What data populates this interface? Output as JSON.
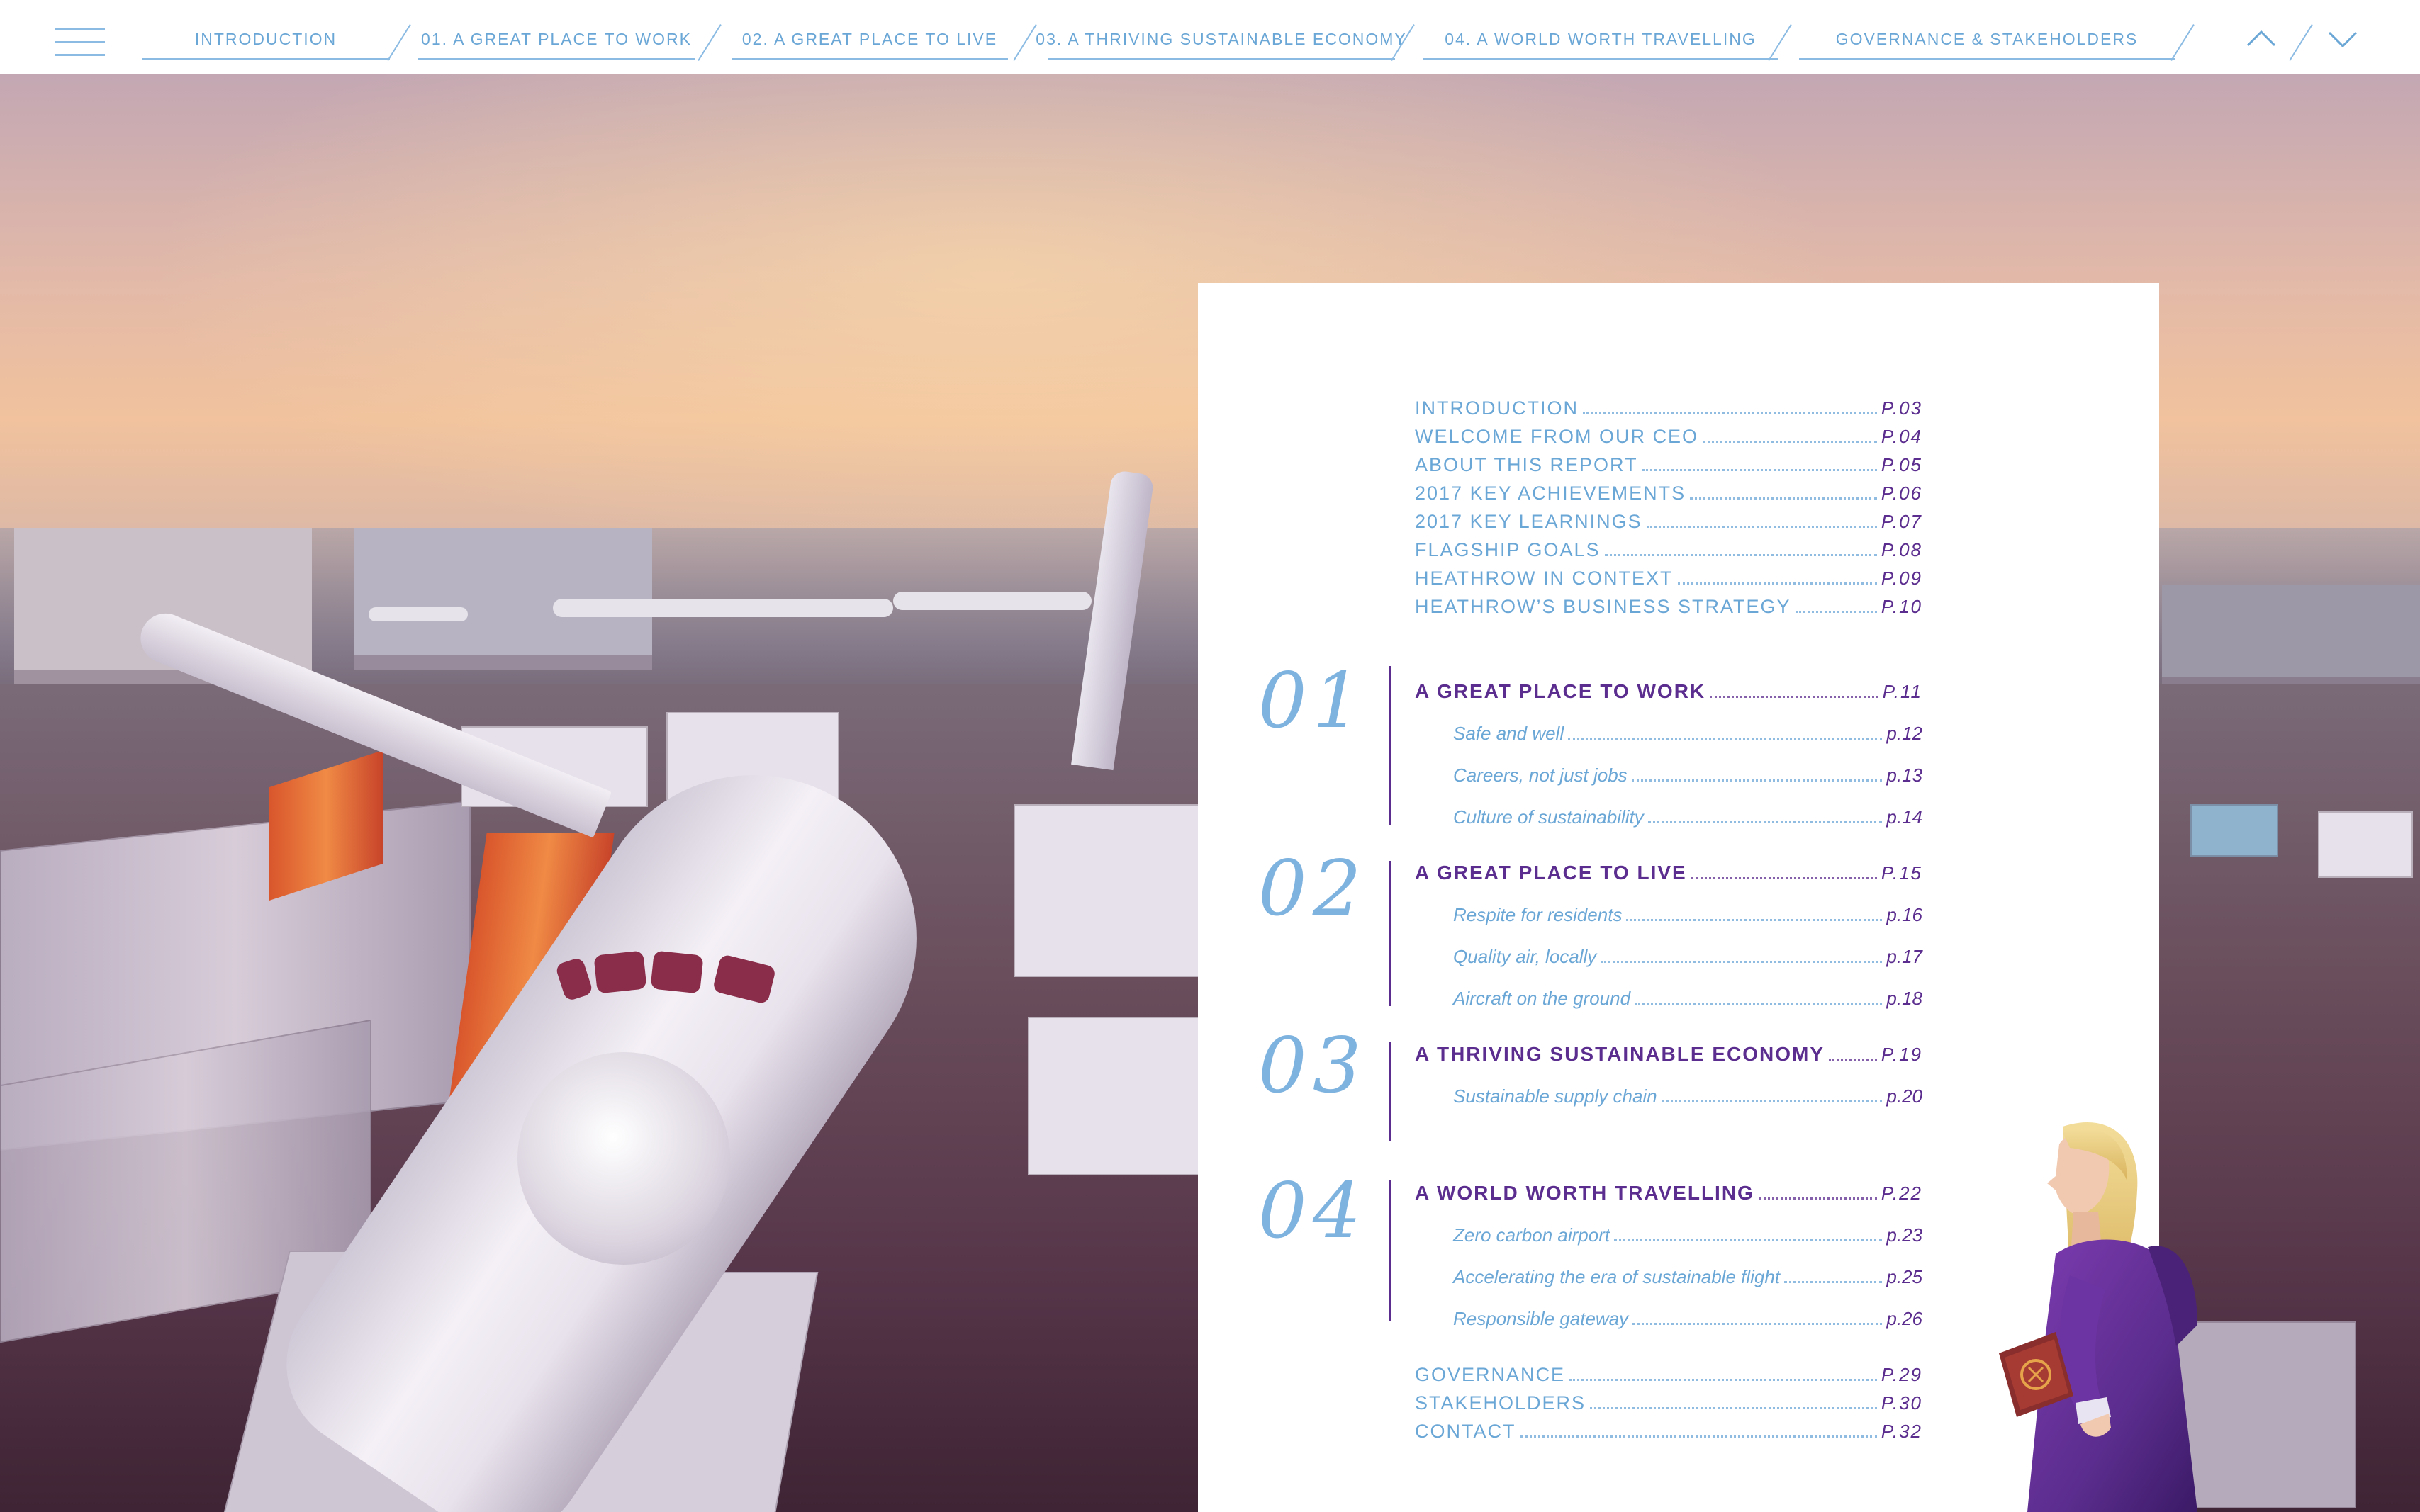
{
  "nav": {
    "menu_icon": "hamburger-menu-icon",
    "tabs": [
      {
        "label": "INTRODUCTION"
      },
      {
        "label": "01. A GREAT PLACE TO WORK"
      },
      {
        "label": "02. A GREAT PLACE TO LIVE"
      },
      {
        "label": "03. A THRIVING SUSTAINABLE ECONOMY"
      },
      {
        "label": "04. A WORLD WORTH TRAVELLING"
      },
      {
        "label": "GOVERNANCE & STAKEHOLDERS"
      }
    ],
    "prev_icon": "chevron-up-icon",
    "next_icon": "chevron-down-icon",
    "accent_color": "#6aa6d6"
  },
  "contents": {
    "intro_items": [
      {
        "label": "INTRODUCTION",
        "page": "p.03"
      },
      {
        "label": "WELCOME FROM OUR CEO",
        "page": "p.04"
      },
      {
        "label": "ABOUT THIS REPORT",
        "page": "p.05"
      },
      {
        "label": "2017 KEY ACHIEVEMENTS",
        "page": "p.06"
      },
      {
        "label": "2017 KEY LEARNINGS",
        "page": "p.07"
      },
      {
        "label": "FLAGSHIP GOALS",
        "page": "p.08"
      },
      {
        "label": "HEATHROW IN CONTEXT",
        "page": "p.09"
      },
      {
        "label": "HEATHROW’S BUSINESS STRATEGY",
        "page": "p.10"
      }
    ],
    "sections": [
      {
        "number": "01",
        "title": "A GREAT PLACE TO WORK",
        "page": "p.11",
        "items": [
          {
            "label": "Safe and well",
            "page": "p.12"
          },
          {
            "label": "Careers, not just jobs",
            "page": "p.13"
          },
          {
            "label": "Culture of sustainability",
            "page": "p.14"
          }
        ]
      },
      {
        "number": "02",
        "title": "A GREAT PLACE TO LIVE",
        "page": "p.15",
        "items": [
          {
            "label": "Respite for residents",
            "page": "p.16"
          },
          {
            "label": "Quality air, locally",
            "page": "p.17"
          },
          {
            "label": "Aircraft on the ground",
            "page": "p.18"
          }
        ]
      },
      {
        "number": "03",
        "title": "A THRIVING SUSTAINABLE ECONOMY",
        "page": "p.19",
        "items": [
          {
            "label": "Sustainable supply chain",
            "page": "p.20"
          }
        ]
      },
      {
        "number": "04",
        "title": "A WORLD WORTH TRAVELLING",
        "page": "p.22",
        "items": [
          {
            "label": "Zero carbon airport",
            "page": "p.23"
          },
          {
            "label": "Accelerating the era of sustainable flight",
            "page": "p.25"
          },
          {
            "label": "Responsible gateway",
            "page": "p.26"
          }
        ]
      }
    ],
    "outro_items": [
      {
        "label": "GOVERNANCE",
        "page": "p.29"
      },
      {
        "label": "STAKEHOLDERS",
        "page": "p.30"
      },
      {
        "label": "CONTACT",
        "page": "p.32"
      }
    ],
    "colors": {
      "light_blue": "#6aa6d6",
      "purple": "#5b2d8e"
    }
  },
  "hero_image": {
    "icon": "airport-airplane-photo"
  },
  "illustration": {
    "icon": "traveller-with-passport-icon"
  }
}
